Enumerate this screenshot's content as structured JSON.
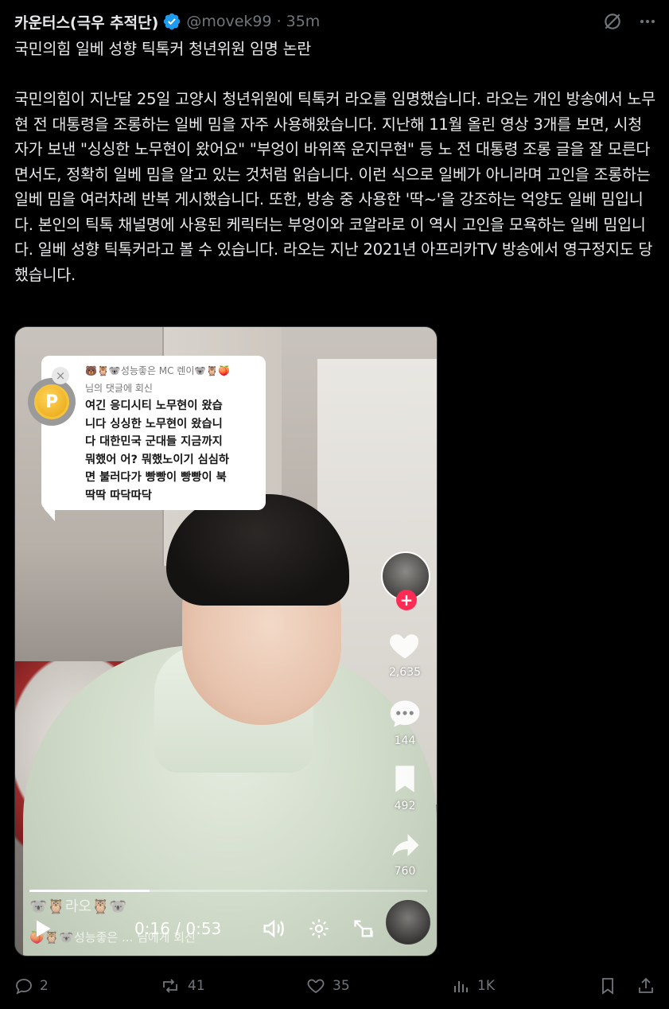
{
  "header": {
    "display_name": "카운터스(극우 추적단)",
    "handle": "@movek99",
    "separator": "·",
    "time_ago": "35m",
    "verified_color": "#1d9bf0",
    "icons": [
      "grok-icon",
      "more-icon"
    ]
  },
  "tweet": {
    "text": "국민의힘 일베 성향 틱톡커 청년위원 임명 논란\n\n국민의힘이 지난달 25일 고양시 청년위원에 틱톡커 라오를 임명했습니다. 라오는 개인 방송에서 노무현 전 대통령을 조롱하는 일베 밈을 자주 사용해왔습니다. 지난해 11월 올린 영상 3개를 보면, 시청자가 보낸 \"싱싱한 노무현이 왔어요\" \"부엉이 바위쪽 운지무현\" 등 노 전 대통령 조롱 글을 잘 모른다면서도, 정확히 일베 밈을 알고 있는 것처럼 읽습니다. 이런 식으로 일베가 아니라며 고인을 조롱하는 일베 밈을 여러차례 반복 게시했습니다. 또한, 방송 중 사용한 '딱~'을 강조하는 억양도 일베 밈입니다. 본인의 틱톡 채널명에 사용된 케릭터는 부엉이와 코알라로 이 역시 고인을 모욕하는 일베 밈입니다. 일베 성향 틱톡커라고 볼 수 있습니다. 라오는 지난 2021년 아프리카TV 방송에서 영구정지도 당했습니다."
  },
  "video": {
    "comment": {
      "header_line1": "🐻🦉🐨성능좋은 MC 렌이🐨🦉🍑",
      "header_line2": "님의 댓글에 회신",
      "body": "여긴 응디시티 노무현이 왔습\n니다 싱싱한 노무현이 왔습니\n다 대한민국 군대들 지금까지\n뭐했어 어? 뭐했노이기 심심하\n면 불러다가 빵빵이 빵빵이 북\n딱딱 따닥따닥",
      "coin_label": "P"
    },
    "side": {
      "likes": "2,635",
      "comments": "144",
      "saves": "492",
      "shares": "760",
      "follow_plus": "+"
    },
    "overlay": {
      "line1": "🐨🦉라오🦉🐨",
      "line2": "🍑🦉🐨성능좋은 ... 님에게 회신"
    },
    "player": {
      "time": "0:16 / 0:53",
      "progress": 0.302
    }
  },
  "actions": {
    "replies": "2",
    "reposts": "41",
    "likes": "35",
    "views": "1K"
  }
}
